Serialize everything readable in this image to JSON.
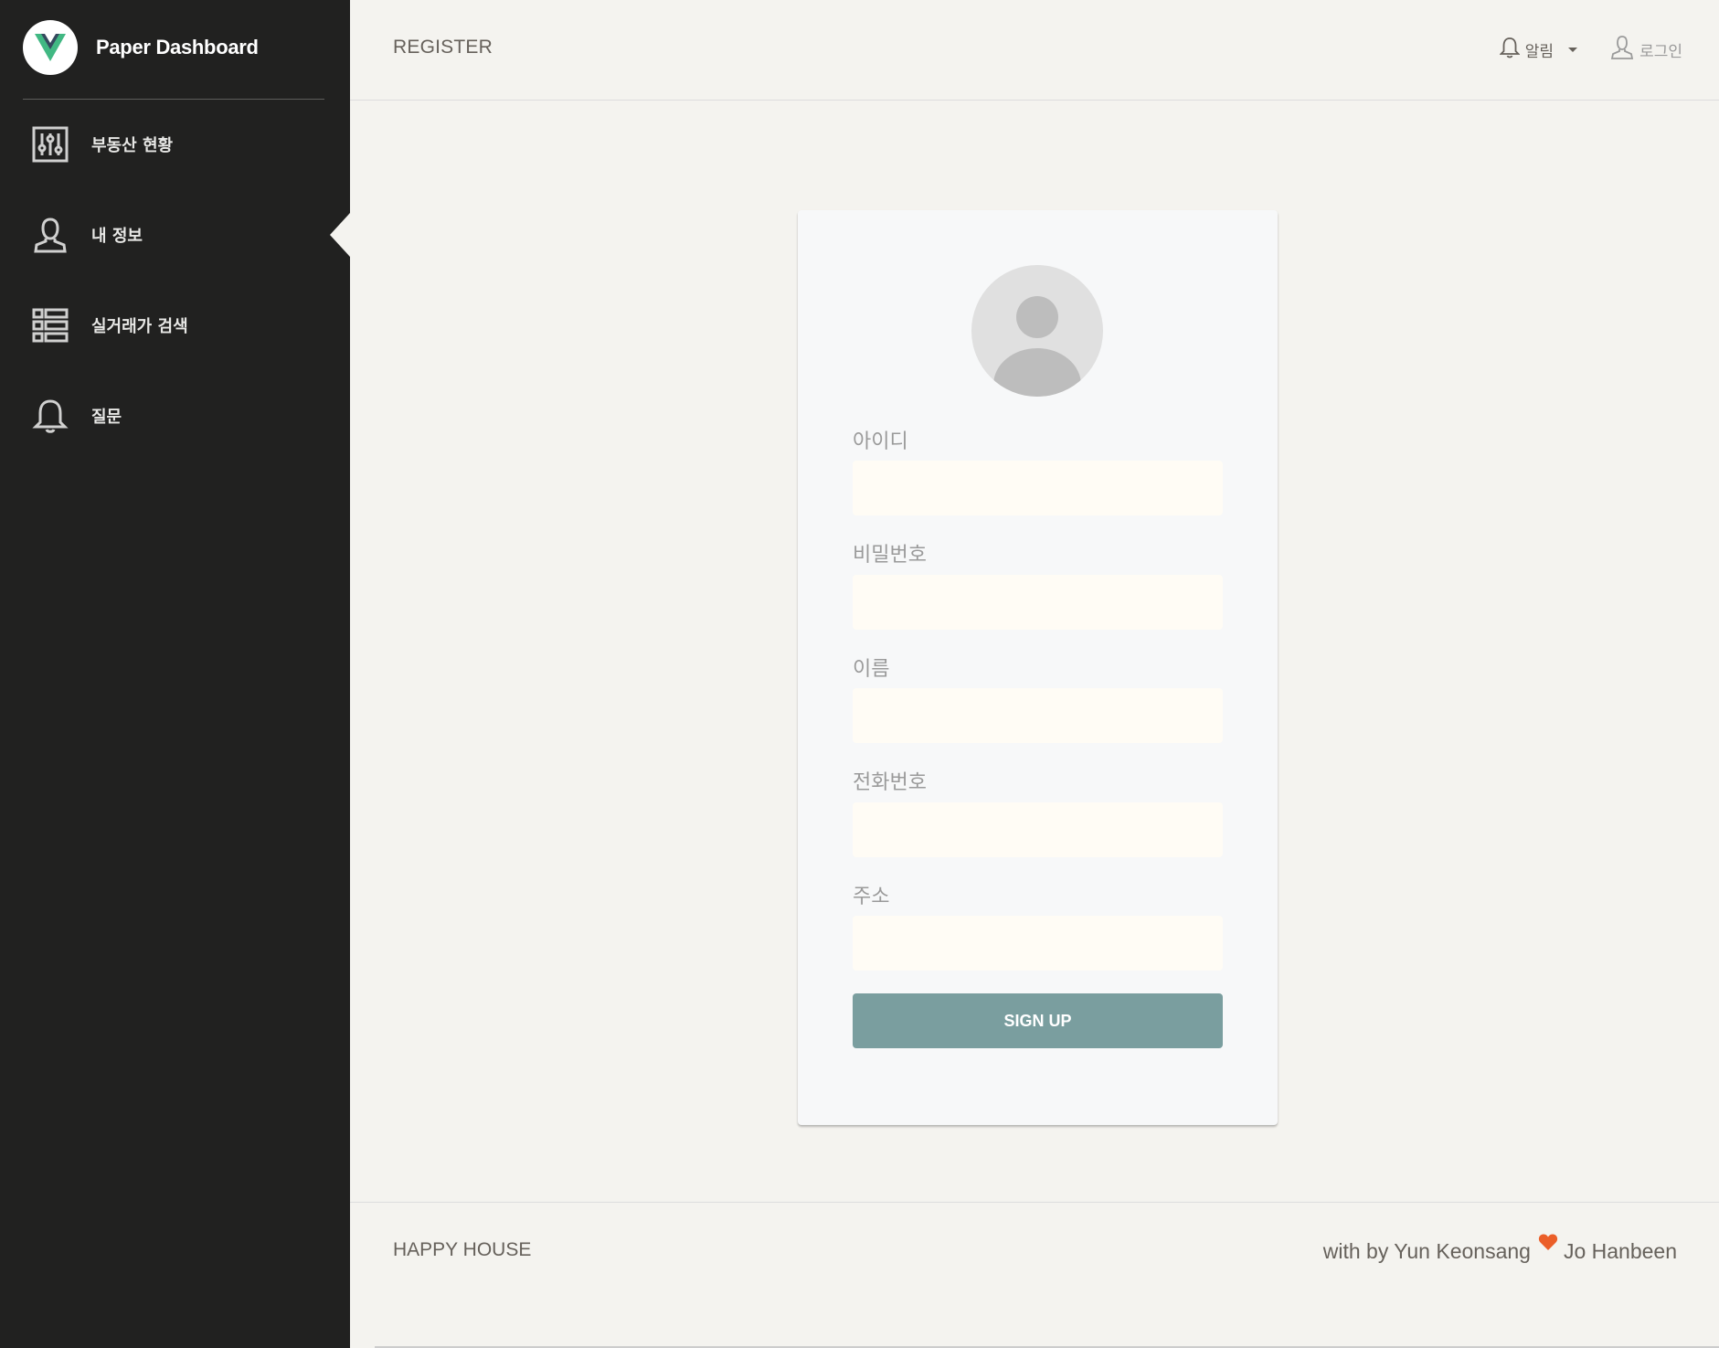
{
  "brand": {
    "name": "Paper Dashboard",
    "logo_icon": "vue-logo-icon",
    "logo_colors": [
      "#41b883",
      "#35495e"
    ]
  },
  "sidebar": {
    "items": [
      {
        "label": "부동산 현황",
        "icon": "sliders-icon"
      },
      {
        "label": "내 정보",
        "icon": "user-icon",
        "active": true
      },
      {
        "label": "실거래가 검색",
        "icon": "table-list-icon"
      },
      {
        "label": "질문",
        "icon": "bell-icon"
      }
    ]
  },
  "navbar": {
    "title": "REGISTER",
    "notifications_label": "알림",
    "login_label": "로그인"
  },
  "form": {
    "fields": [
      {
        "label": "아이디",
        "value": ""
      },
      {
        "label": "비밀번호",
        "value": ""
      },
      {
        "label": "이름",
        "value": ""
      },
      {
        "label": "전화번호",
        "value": ""
      },
      {
        "label": "주소",
        "value": ""
      }
    ],
    "submit_label": "SIGN UP"
  },
  "footer": {
    "left": "HAPPY HOUSE",
    "right_prefix": "with by Yun Keonsang",
    "right_suffix": "Jo Hanbeen",
    "heart_color": "#eb5e28"
  },
  "colors": {
    "sidebar_bg": "#212120",
    "page_bg": "#f4f3ef",
    "button_bg": "#7a9e9f",
    "input_bg": "#fffcf5"
  }
}
